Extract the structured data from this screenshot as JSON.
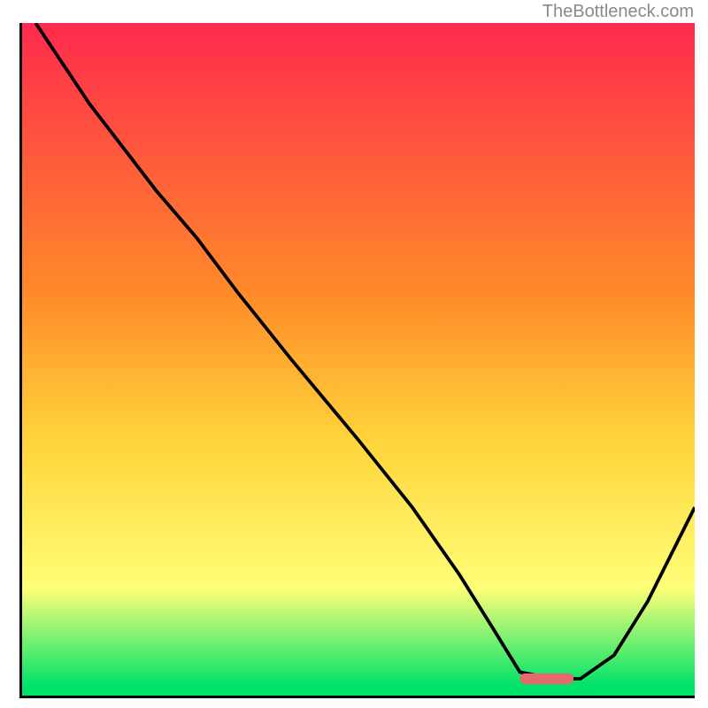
{
  "watermark": "TheBottleneck.com",
  "colors": {
    "top": "#ff2a4d",
    "mid1": "#ff8a2a",
    "mid2": "#ffd43a",
    "mid3": "#ffff78",
    "bottom": "#00e36a",
    "marker": "#e46a6e",
    "line": "#000000"
  },
  "chart_data": {
    "type": "line",
    "title": "",
    "xlabel": "",
    "ylabel": "",
    "xlim": [
      0,
      100
    ],
    "ylim": [
      0,
      100
    ],
    "x": [
      2,
      10,
      20,
      26,
      32,
      40,
      50,
      58,
      65,
      70,
      74,
      79,
      83,
      88,
      93,
      100
    ],
    "values": [
      100,
      88,
      75,
      68,
      60,
      50,
      38,
      28,
      18,
      10,
      3.5,
      2.5,
      2.5,
      6,
      14,
      28
    ],
    "optimum_band": {
      "x0": 74,
      "x1": 82,
      "y": 2.5
    }
  }
}
